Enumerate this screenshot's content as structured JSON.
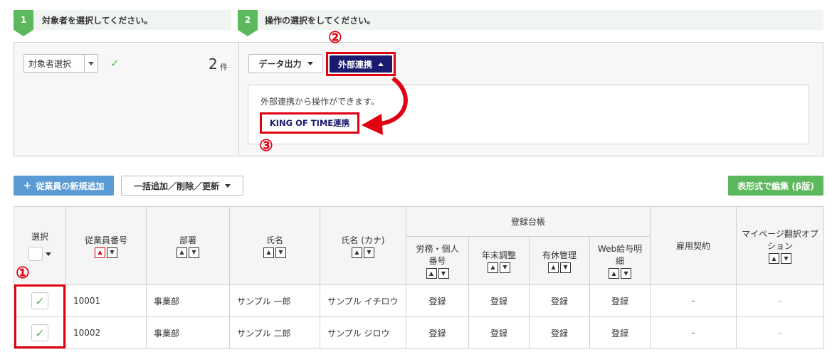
{
  "steps": [
    {
      "num": "1",
      "label": "対象者を選択してください。"
    },
    {
      "num": "2",
      "label": "操作の選択をしてください。"
    }
  ],
  "target": {
    "select_label": "対象者選択",
    "count": "2",
    "count_unit": "件"
  },
  "operation": {
    "data_output": "データ出力",
    "external": "外部連携",
    "hint": "外部連携から操作ができます。",
    "kot": "KING OF TIME連携"
  },
  "annotations": {
    "c1": "①",
    "c2": "②",
    "c3": "③"
  },
  "toolbar": {
    "add_employee": "従業員の新規追加",
    "bulk": "一括追加／削除／更新",
    "table_edit": "表形式で編集 (β版)"
  },
  "table": {
    "headers": {
      "select": "選択",
      "emp_no": "従業員番号",
      "dept": "部署",
      "name": "氏名",
      "kana": "氏名 (カナ)",
      "ledger": "登録台帳",
      "labor": "労務・個人番号",
      "yearend": "年末調整",
      "leave": "有休管理",
      "web": "Web給与明細",
      "contract": "雇用契約",
      "mypage": "マイページ翻訳オプション"
    },
    "rows": [
      {
        "emp_no": "10001",
        "dept": "事業部",
        "name": "サンプル 一郎",
        "kana": "サンプル イチロウ",
        "labor": "登録",
        "yearend": "登録",
        "leave": "登録",
        "web": "登録",
        "contract": "-",
        "mypage": "-"
      },
      {
        "emp_no": "10002",
        "dept": "事業部",
        "name": "サンプル 二郎",
        "kana": "サンプル ジロウ",
        "labor": "登録",
        "yearend": "登録",
        "leave": "登録",
        "web": "登録",
        "contract": "-",
        "mypage": "-"
      }
    ]
  },
  "colors": {
    "green": "#5cb85c",
    "navy": "#1a1a6e",
    "red": "#e00012",
    "blue_btn": "#5b9bd5"
  }
}
